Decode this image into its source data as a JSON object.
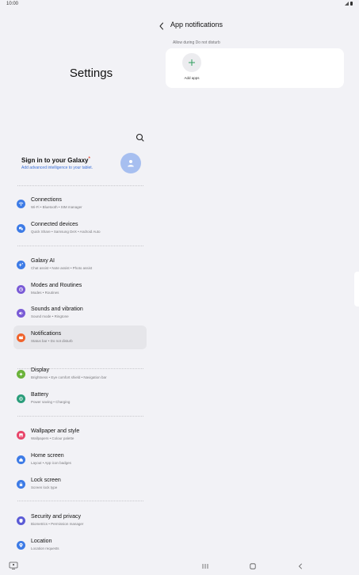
{
  "status_bar": {
    "time": "10:00",
    "signal_icon": "signal-icon",
    "battery_icon": "battery-icon"
  },
  "settings": {
    "title": "Settings",
    "search_icon": "search-icon",
    "account": {
      "title": "Sign in to your Galaxy",
      "star": "*",
      "subtitle": "Add advanced intelligence to your tablet.",
      "icon": "person-icon"
    },
    "menu": [
      {
        "id": "connections",
        "title": "Connections",
        "subtitle": "Wi-Fi  •  Bluetooth  •  SIM manager",
        "icon": "wifi-icon",
        "color": "#3d7be6"
      },
      {
        "id": "connected-devices",
        "title": "Connected devices",
        "subtitle": "Quick Share  •  Samsung DeX  •  Android Auto",
        "icon": "devices-icon",
        "color": "#3d7be6"
      },
      {
        "id": "galaxy-ai",
        "title": "Galaxy AI",
        "subtitle": "Chat assist  •  Note assist  •  Photo assist",
        "icon": "galaxy-ai-icon",
        "color": "#3d7be6"
      },
      {
        "id": "modes-routines",
        "title": "Modes and Routines",
        "subtitle": "Modes  •  Routines",
        "icon": "modes-icon",
        "color": "#7a5bd6"
      },
      {
        "id": "sounds-vibration",
        "title": "Sounds and vibration",
        "subtitle": "Sound mode  •  Ringtone",
        "icon": "sound-icon",
        "color": "#7a5bd6"
      },
      {
        "id": "notifications",
        "title": "Notifications",
        "subtitle": "Status bar  •  Do not disturb",
        "icon": "notification-icon",
        "color": "#f0632c"
      },
      {
        "id": "display",
        "title": "Display",
        "subtitle": "Brightness  •  Eye comfort shield  •  Navigation bar",
        "icon": "display-icon",
        "color": "#6ab23a"
      },
      {
        "id": "battery",
        "title": "Battery",
        "subtitle": "Power saving  •  Charging",
        "icon": "battery-icon",
        "color": "#2a9d7a"
      },
      {
        "id": "wallpaper-style",
        "title": "Wallpaper and style",
        "subtitle": "Wallpapers  •  Colour palette",
        "icon": "wallpaper-icon",
        "color": "#e8456a"
      },
      {
        "id": "home-screen",
        "title": "Home screen",
        "subtitle": "Layout  •  App icon badges",
        "icon": "home-icon",
        "color": "#3d7be6"
      },
      {
        "id": "lock-screen",
        "title": "Lock screen",
        "subtitle": "Screen lock type",
        "icon": "lock-icon",
        "color": "#3d7be6"
      },
      {
        "id": "security-privacy",
        "title": "Security and privacy",
        "subtitle": "Biometrics  •  Permission manager",
        "icon": "shield-icon",
        "color": "#5b5bd6"
      },
      {
        "id": "location",
        "title": "Location",
        "subtitle": "Location requests",
        "icon": "location-icon",
        "color": "#3d7be6"
      }
    ],
    "selected": "notifications"
  },
  "app_notifications": {
    "title": "App notifications",
    "back_icon": "back-arrow-icon",
    "section_label": "Allow during Do not disturb",
    "add_apps_label": "Add apps",
    "add_icon": "plus-icon"
  },
  "nav_bar": {
    "recents": "recents-icon",
    "home": "home-nav-icon",
    "back": "back-nav-icon",
    "keyboard": "keyboard-icon"
  }
}
